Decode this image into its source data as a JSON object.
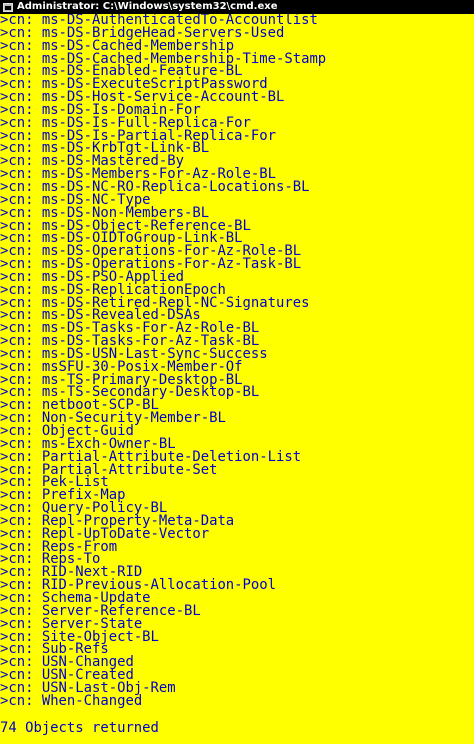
{
  "window": {
    "title": "Administrator: C:\\Windows\\system32\\cmd.exe",
    "icon": "cmd-icon",
    "background": "#ffff00",
    "text_color": "#0000cc"
  },
  "console": {
    "prefix": ">cn: ",
    "lines": [
      "ms-DS-AuthenticatedTo-Accountlist",
      "ms-DS-BridgeHead-Servers-Used",
      "ms-DS-Cached-Membership",
      "ms-DS-Cached-Membership-Time-Stamp",
      "ms-DS-Enabled-Feature-BL",
      "ms-DS-ExecuteScriptPassword",
      "ms-DS-Host-Service-Account-BL",
      "ms-DS-Is-Domain-For",
      "ms-DS-Is-Full-Replica-For",
      "ms-DS-Is-Partial-Replica-For",
      "ms-DS-KrbTgt-Link-BL",
      "ms-DS-Mastered-By",
      "ms-DS-Members-For-Az-Role-BL",
      "ms-DS-NC-RO-Replica-Locations-BL",
      "ms-DS-NC-Type",
      "ms-DS-Non-Members-BL",
      "ms-DS-Object-Reference-BL",
      "ms-DS-OIDToGroup-Link-BL",
      "ms-DS-Operations-For-Az-Role-BL",
      "ms-DS-Operations-For-Az-Task-BL",
      "ms-DS-PSO-Applied",
      "ms-DS-ReplicationEpoch",
      "ms-DS-Retired-Repl-NC-Signatures",
      "ms-DS-Revealed-DSAs",
      "ms-DS-Tasks-For-Az-Role-BL",
      "ms-DS-Tasks-For-Az-Task-BL",
      "ms-DS-USN-Last-Sync-Success",
      "msSFU-30-Posix-Member-Of",
      "ms-TS-Primary-Desktop-BL",
      "ms-TS-Secondary-Desktop-BL",
      "netboot-SCP-BL",
      "Non-Security-Member-BL",
      "Object-Guid",
      "ms-Exch-Owner-BL",
      "Partial-Attribute-Deletion-List",
      "Partial-Attribute-Set",
      "Pek-List",
      "Prefix-Map",
      "Query-Policy-BL",
      "Repl-Property-Meta-Data",
      "Repl-UpToDate-Vector",
      "Reps-From",
      "Reps-To",
      "RID-Next-RID",
      "RID-Previous-Allocation-Pool",
      "Schema-Update",
      "Server-Reference-BL",
      "Server-State",
      "Site-Object-BL",
      "Sub-Refs",
      "USN-Changed",
      "USN-Created",
      "USN-Last-Obj-Rem",
      "When-Changed"
    ],
    "summary": "74 Objects returned"
  }
}
